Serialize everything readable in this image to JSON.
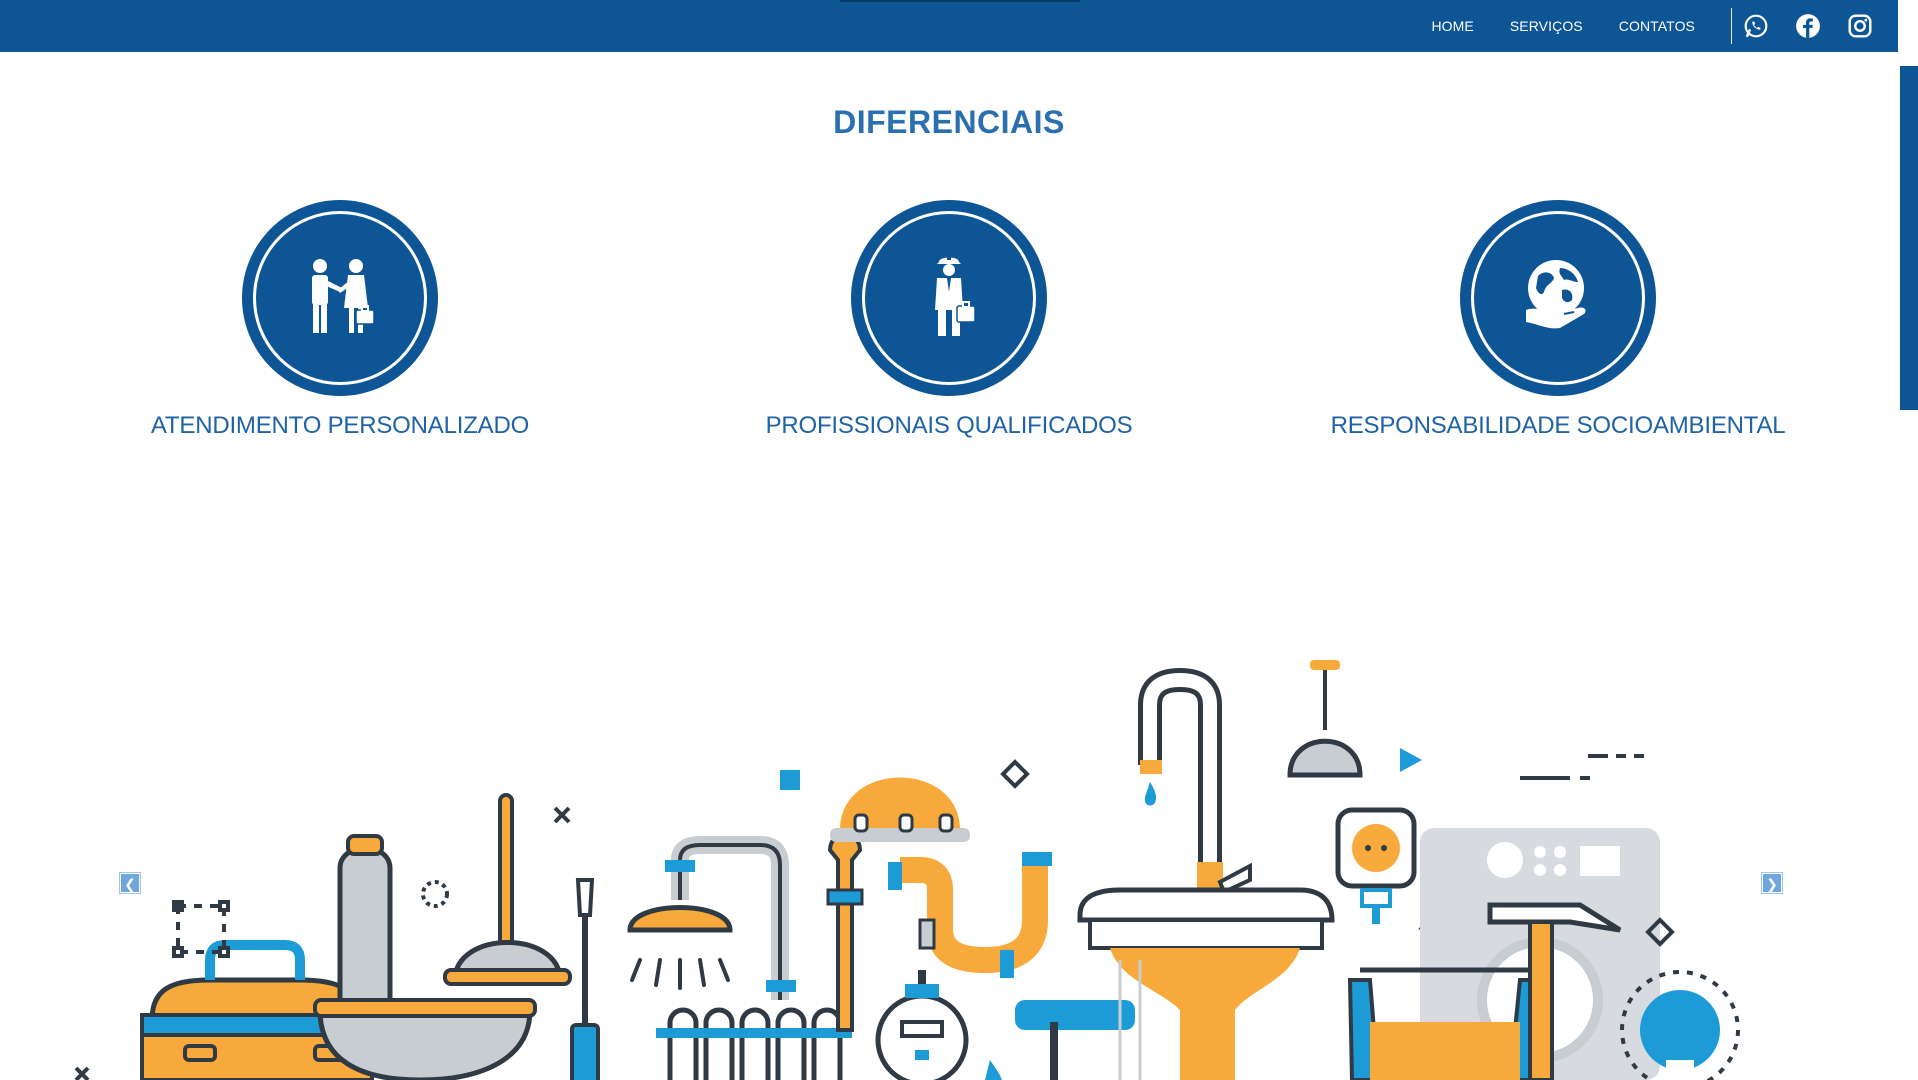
{
  "nav": {
    "items": [
      {
        "label": "HOME"
      },
      {
        "label": "SERVIÇOS"
      },
      {
        "label": "CONTATOS"
      }
    ],
    "social": [
      "whatsapp-icon",
      "facebook-icon",
      "instagram-icon"
    ]
  },
  "section": {
    "title": "DIFERENCIAIS",
    "features": [
      {
        "label": "ATENDIMENTO PERSONALIZADO",
        "icon": "handshake-people-icon"
      },
      {
        "label": "PROFISSIONAIS QUALIFICADOS",
        "icon": "worker-with-briefcase-icon"
      },
      {
        "label": "RESPONSABILIDADE SOCIOAMBIENTAL",
        "icon": "globe-in-hand-icon"
      }
    ]
  },
  "carousel": {
    "prev_label": "❮",
    "next_label": "❯"
  },
  "colors": {
    "primary": "#0d5595",
    "title": "#2a6fb0",
    "orange": "#f7a93b",
    "cyan": "#1d9bd7",
    "gray": "#c8cdd2",
    "dark": "#2f3a45"
  }
}
